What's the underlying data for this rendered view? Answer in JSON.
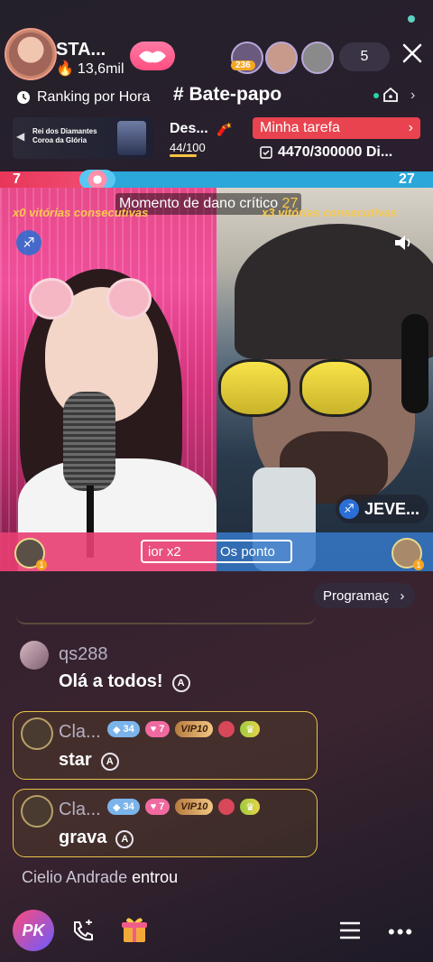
{
  "host": {
    "name": "STA...",
    "likes": "13,6mil"
  },
  "viewers": {
    "badge": "236",
    "count": "5"
  },
  "top_tabs": {
    "ranking": "Ranking por Hora",
    "chat": "# Bate-papo"
  },
  "banner": {
    "title": "Rei dos Diamantes\nCoroa da Glória",
    "des_label": "Des...",
    "des_progress": "44/100",
    "task_label": "Minha tarefa",
    "task_score": "4470/300000 Di..."
  },
  "pk": {
    "left_score": "7",
    "right_score": "27",
    "damage_label": "Momento de dano crítico",
    "damage_value": "27",
    "left_streak": "x0 vitórias consecutivas",
    "right_streak": "x3 vitórias consecutivas",
    "right_user": "JEVE...",
    "boost_a": "ior x2",
    "boost_b": "Os ponto"
  },
  "programa": "Programaç",
  "messages": [
    {
      "user": "qs288",
      "text": "Olá a todos!"
    },
    {
      "user": "Cla...",
      "text": "star",
      "level": "34",
      "hearts": "7",
      "vip": "VIP10"
    },
    {
      "user": "Cla...",
      "text": "grava",
      "level": "34",
      "hearts": "7",
      "vip": "VIP10"
    }
  ],
  "joined": {
    "user": "Cielio Andrade",
    "action": "entrou"
  },
  "bottom": {
    "pk_label": "PK"
  },
  "colors": {
    "accent_pink": "#ff4f81",
    "task_red": "#e8434e",
    "gold_border": "#e8c44a",
    "pk_blue": "#2ba7d9"
  }
}
